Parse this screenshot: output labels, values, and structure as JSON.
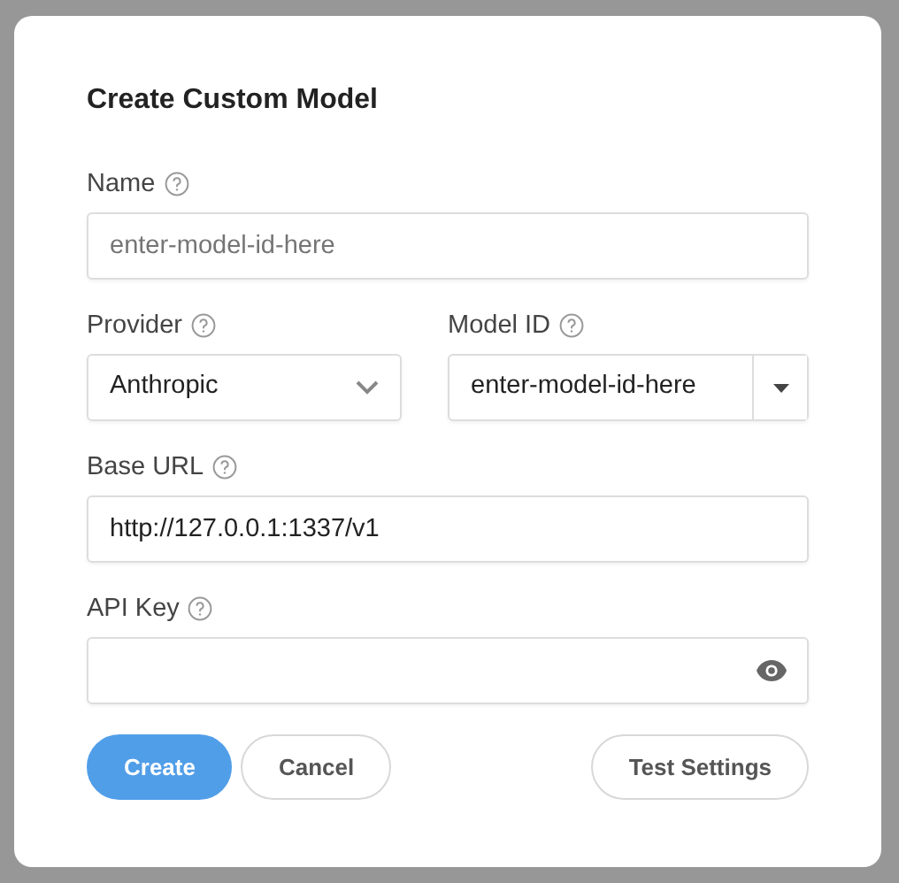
{
  "dialog": {
    "title": "Create Custom Model"
  },
  "fields": [
    {
      "kind": "text",
      "label": "Name",
      "placeholder": "enter-model-id-here"
    },
    {
      "kind": "select",
      "label": "Provider",
      "value": "Anthropic"
    },
    {
      "kind": "combo",
      "label": "Model ID",
      "value": "enter-model-id-here"
    },
    {
      "kind": "text",
      "label": "Base URL",
      "value": "http://127.0.0.1:1337/v1"
    },
    {
      "kind": "password",
      "label": "API Key"
    }
  ],
  "buttons": [
    {
      "label": "Create",
      "kind": "primary"
    },
    {
      "label": "Cancel",
      "kind": "secondary"
    },
    {
      "label": "Test Settings",
      "kind": "secondary"
    }
  ]
}
